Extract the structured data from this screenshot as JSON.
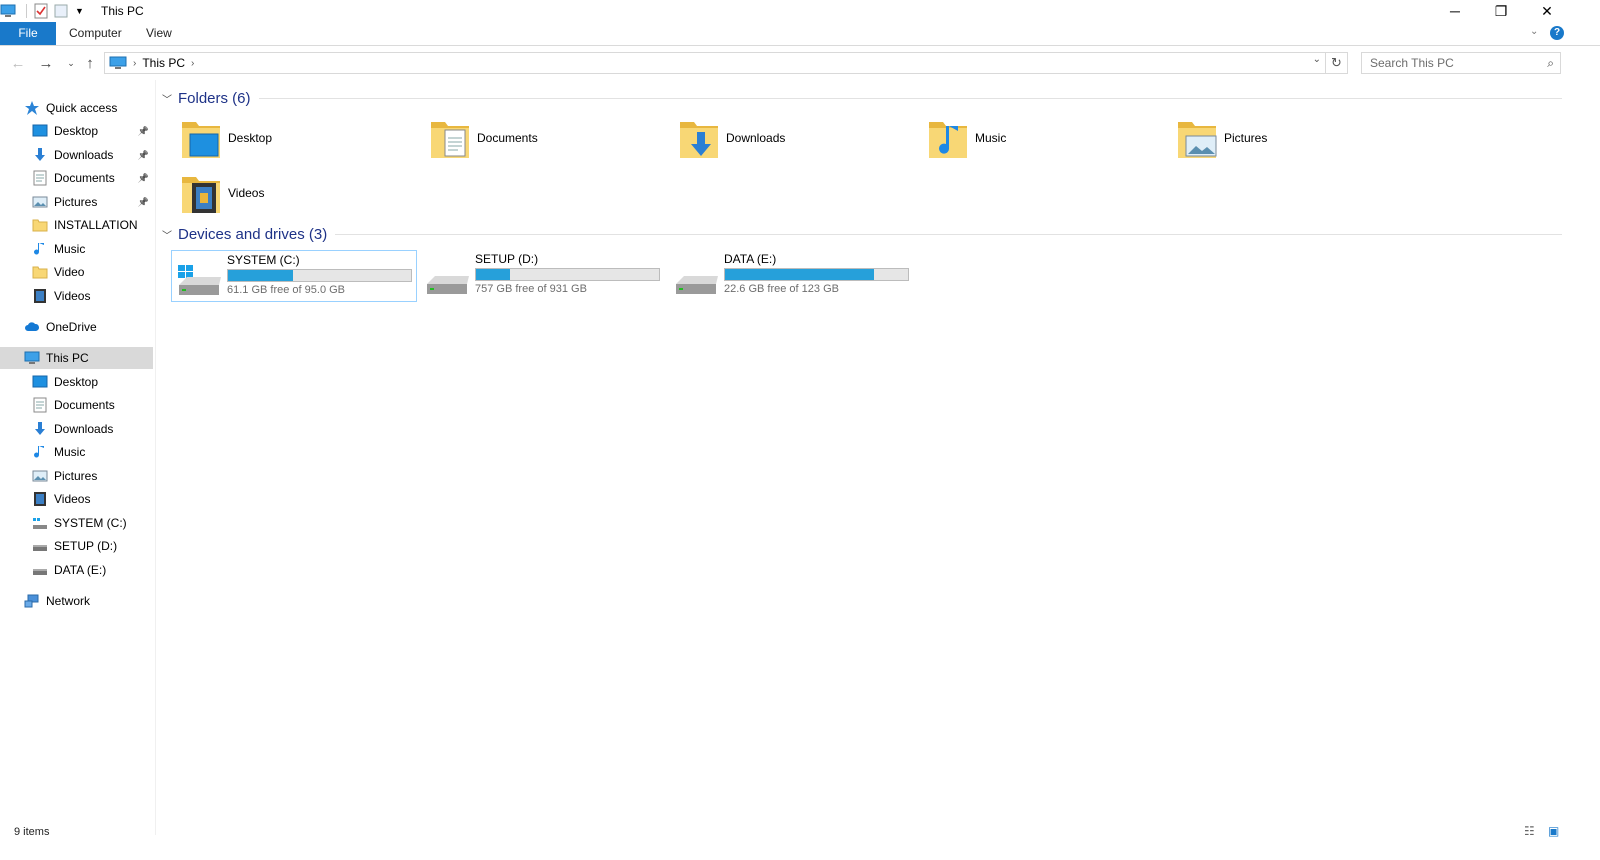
{
  "window": {
    "title": "This PC"
  },
  "ribbon": {
    "tabs": [
      "File",
      "Computer",
      "View"
    ]
  },
  "address": {
    "root_label": "This PC"
  },
  "search": {
    "placeholder": "Search This PC"
  },
  "sidebar": {
    "items": [
      {
        "label": "Quick access",
        "icon": "star-icon",
        "level": 0
      },
      {
        "label": "Desktop",
        "icon": "desktop-icon",
        "level": 1,
        "pinned": true
      },
      {
        "label": "Downloads",
        "icon": "download-icon",
        "level": 1,
        "pinned": true
      },
      {
        "label": "Documents",
        "icon": "documents-icon",
        "level": 1,
        "pinned": true
      },
      {
        "label": "Pictures",
        "icon": "pictures-icon",
        "level": 1,
        "pinned": true
      },
      {
        "label": "INSTALLATION",
        "icon": "folder-icon",
        "level": 1
      },
      {
        "label": "Music",
        "icon": "music-icon",
        "level": 1
      },
      {
        "label": "Video",
        "icon": "folder-icon",
        "level": 1
      },
      {
        "label": "Videos",
        "icon": "videos-icon",
        "level": 1
      },
      {
        "label": "OneDrive",
        "icon": "cloud-icon",
        "level": 0
      },
      {
        "label": "This PC",
        "icon": "computer-icon",
        "level": 0,
        "selected": true
      },
      {
        "label": "Desktop",
        "icon": "desktop-icon",
        "level": 1
      },
      {
        "label": "Documents",
        "icon": "documents-icon",
        "level": 1
      },
      {
        "label": "Downloads",
        "icon": "download-icon",
        "level": 1
      },
      {
        "label": "Music",
        "icon": "music-icon",
        "level": 1
      },
      {
        "label": "Pictures",
        "icon": "pictures-icon",
        "level": 1
      },
      {
        "label": "Videos",
        "icon": "videos-icon",
        "level": 1
      },
      {
        "label": "SYSTEM (C:)",
        "icon": "system-drive-icon",
        "level": 1
      },
      {
        "label": "SETUP (D:)",
        "icon": "drive-icon",
        "level": 1
      },
      {
        "label": "DATA (E:)",
        "icon": "drive-icon",
        "level": 1
      },
      {
        "label": "Network",
        "icon": "network-icon",
        "level": 0
      }
    ]
  },
  "folders_group": {
    "title": "Folders (6)"
  },
  "folders": [
    {
      "label": "Desktop",
      "icon": "desktop-folder-icon"
    },
    {
      "label": "Documents",
      "icon": "documents-folder-icon"
    },
    {
      "label": "Downloads",
      "icon": "downloads-folder-icon"
    },
    {
      "label": "Music",
      "icon": "music-folder-icon"
    },
    {
      "label": "Pictures",
      "icon": "pictures-folder-icon"
    },
    {
      "label": "Videos",
      "icon": "videos-folder-icon"
    }
  ],
  "drives_group": {
    "title": "Devices and drives (3)"
  },
  "drives": [
    {
      "label": "SYSTEM (C:)",
      "free_text": "61.1 GB free of 95.0 GB",
      "used_fraction": 0.357,
      "system": true,
      "selected": true
    },
    {
      "label": "SETUP (D:)",
      "free_text": "757 GB free of 931 GB",
      "used_fraction": 0.187
    },
    {
      "label": "DATA (E:)",
      "free_text": "22.6 GB free of 123 GB",
      "used_fraction": 0.816
    }
  ],
  "status": {
    "count": "9 items"
  },
  "colors": {
    "accent": "#1979ca",
    "bar": "#26a0da",
    "group_title": "#1e3287"
  }
}
